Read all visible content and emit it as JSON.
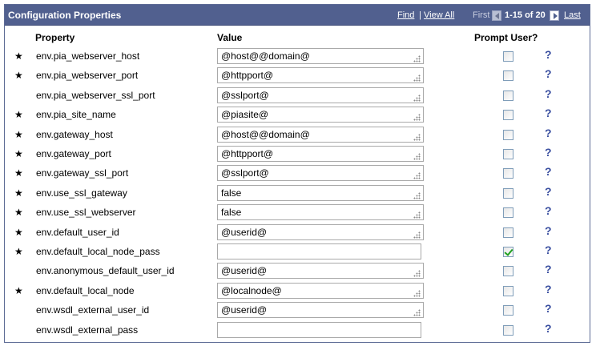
{
  "panel": {
    "title": "Configuration Properties",
    "nav": {
      "find": "Find",
      "separator": "|",
      "view_all": "View All",
      "first": "First",
      "count": "1-15 of 20",
      "last": "Last"
    }
  },
  "columns": {
    "property": "Property",
    "value": "Value",
    "prompt": "Prompt User?"
  },
  "rows": [
    {
      "required": true,
      "property": "env.pia_webserver_host",
      "value": "@host@@domain@",
      "checked": false
    },
    {
      "required": true,
      "property": "env.pia_webserver_port",
      "value": "@httpport@",
      "checked": false
    },
    {
      "required": false,
      "property": "env.pia_webserver_ssl_port",
      "value": "@sslport@",
      "checked": false
    },
    {
      "required": true,
      "property": "env.pia_site_name",
      "value": "@piasite@",
      "checked": false
    },
    {
      "required": true,
      "property": "env.gateway_host",
      "value": "@host@@domain@",
      "checked": false
    },
    {
      "required": true,
      "property": "env.gateway_port",
      "value": "@httpport@",
      "checked": false
    },
    {
      "required": true,
      "property": "env.gateway_ssl_port",
      "value": "@sslport@",
      "checked": false
    },
    {
      "required": true,
      "property": "env.use_ssl_gateway",
      "value": "false",
      "checked": false
    },
    {
      "required": true,
      "property": "env.use_ssl_webserver",
      "value": "false",
      "checked": false
    },
    {
      "required": true,
      "property": "env.default_user_id",
      "value": "@userid@",
      "checked": false
    },
    {
      "required": true,
      "property": "env.default_local_node_pass",
      "value": "",
      "checked": true
    },
    {
      "required": false,
      "property": "env.anonymous_default_user_id",
      "value": "@userid@",
      "checked": false
    },
    {
      "required": true,
      "property": "env.default_local_node",
      "value": "@localnode@",
      "checked": false
    },
    {
      "required": false,
      "property": "env.wsdl_external_user_id",
      "value": "@userid@",
      "checked": false
    },
    {
      "required": false,
      "property": "env.wsdl_external_pass",
      "value": "",
      "checked": false
    }
  ],
  "symbols": {
    "star": "★",
    "help": "?"
  },
  "colors": {
    "header_bg": "#51608f",
    "header_text": "#ffffff",
    "help_icon": "#3a4fa0"
  }
}
